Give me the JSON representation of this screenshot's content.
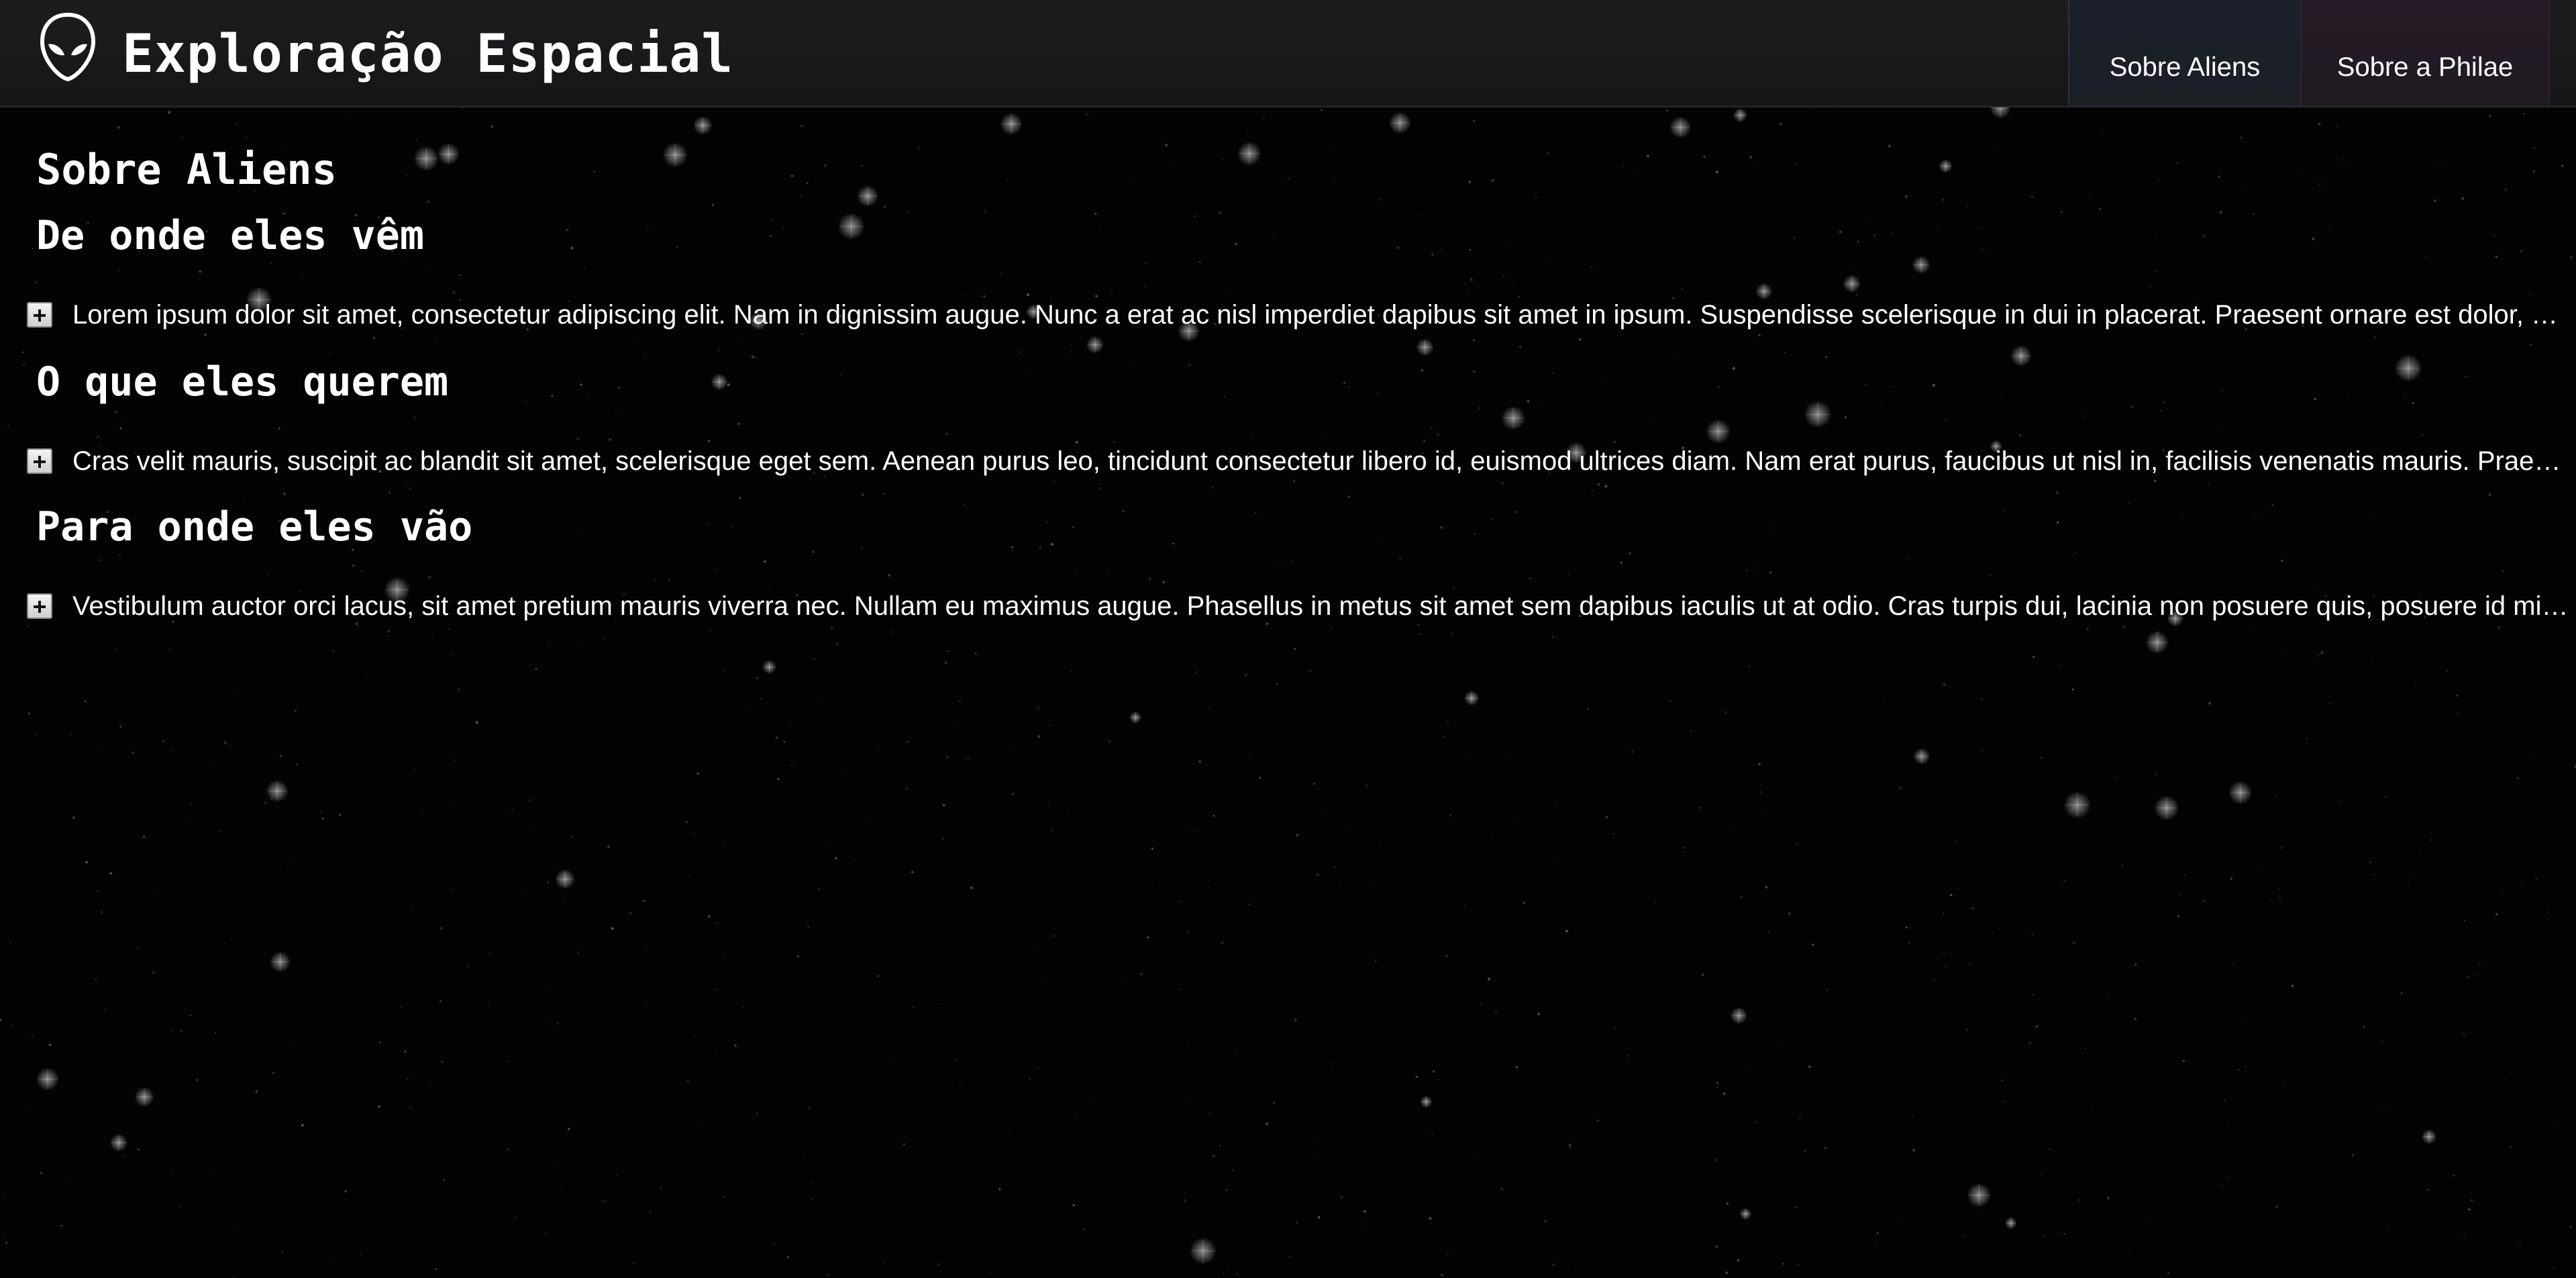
{
  "header": {
    "logo_icon": "alien-head-icon",
    "title": "Exploração Espacial",
    "nav": [
      {
        "label": "Sobre Aliens"
      },
      {
        "label": "Sobre a Philae"
      }
    ]
  },
  "main": {
    "heading": "Sobre Aliens",
    "sections": [
      {
        "title": "De onde eles vêm",
        "toggle_icon": "plus-icon",
        "text": "Lorem ipsum dolor sit amet, consectetur adipiscing elit. Nam in dignissim augue. Nunc a erat ac nisl imperdiet dapibus sit amet in ipsum. Suspendisse scelerisque in dui in placerat. Praesent ornare est dolor, at phar…"
      },
      {
        "title": "O que eles querem",
        "toggle_icon": "plus-icon",
        "text": "Cras velit mauris, suscipit ac blandit sit amet, scelerisque eget sem. Aenean purus leo, tincidunt consectetur libero id, euismod ultrices diam. Nam erat purus, faucibus ut nisl in, facilisis venenatis mauris. Praesent m…"
      },
      {
        "title": "Para onde eles vão",
        "toggle_icon": "plus-icon",
        "text": "Vestibulum auctor orci lacus, sit amet pretium mauris viverra nec. Nullam eu maximus augue. Phasellus in metus sit amet sem dapibus iaculis ut at odio. Cras turpis dui, lacinia non posuere quis, posuere id mi. Etiam…"
      }
    ]
  },
  "colors": {
    "background": "#030303",
    "header": "#1b1b1c",
    "text": "#ffffff",
    "nav_aliens": "#1b1f28",
    "nav_philae": "#231b24"
  }
}
